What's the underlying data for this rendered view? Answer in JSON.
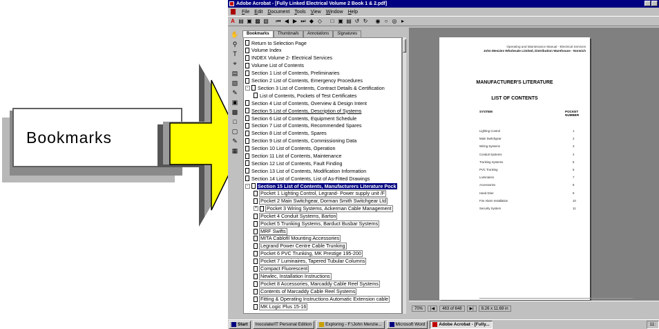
{
  "callout": {
    "label": "Bookmarks"
  },
  "window": {
    "title": "Adobe Acrobat - [Fully Linked Electrical Volume 2 Book 1 & 2.pdf]"
  },
  "menu": [
    "File",
    "Edit",
    "Document",
    "Tools",
    "View",
    "Window",
    "Help"
  ],
  "nav_tabs": [
    "Bookmarks",
    "Thumbnails",
    "Annotations",
    "Signatures"
  ],
  "bookmarks": [
    {
      "label": "Return to Selection Page"
    },
    {
      "label": "Volume Index"
    },
    {
      "label": "INDEX Volume 2- Electrical Services"
    },
    {
      "label": "Volume List of Contents"
    },
    {
      "label": "Section 1 List of Contents, Preliminaries"
    },
    {
      "label": "Section 2 List of Contents, Emergency Procedures"
    },
    {
      "label": "Section 3 List of Contents, Contract Details & Certification"
    },
    {
      "label": "List of Contents, Pockets of Test Certificates"
    },
    {
      "label": "Section 4 List of Contents, Overview & Design Intent"
    },
    {
      "label": "Section 5 List of Contents, Description of Systems"
    },
    {
      "label": "Section 6 List of Contents, Equipment Schedule"
    },
    {
      "label": "Section 7 List of Contents, Recommended Spares"
    },
    {
      "label": "Section 8 List of Contents, Spares"
    },
    {
      "label": "Section 9 List of Contents, Commissioning Data"
    },
    {
      "label": "Section 10 List of Contents, Operation"
    },
    {
      "label": "Section 11 List of Contents, Maintenance"
    },
    {
      "label": "Section 12 List of Contents, Fault Finding"
    },
    {
      "label": "Section 13 List of Contents, Modification Information"
    },
    {
      "label": "Section 14 List of Contents, List of As-Fitted Drawings"
    },
    {
      "label": "Section 15 List of Contents, Manufacturers Literature Pock"
    },
    {
      "label": "Pocket 1 Lighting Control, Legrand- Power supply unit /F"
    },
    {
      "label": "Pocket 2 Main Switchgear, Dorman Smith Switchgear Ltd"
    },
    {
      "label": "Pocket 3 Wiring Systems, Ackerman Cable Management"
    },
    {
      "label": "Pocket 4 Conduit Systems, Barton"
    },
    {
      "label": "Pocket 5 Trunking Systems, Barduct Busbar Systems"
    },
    {
      "label": "MRF Swifts"
    },
    {
      "label": "MITA Cablofil Mounting Accessories"
    },
    {
      "label": "Legrand Power Centre Cable Trunking"
    },
    {
      "label": "Pocket 6 PVC Trunking, MK Prestige 195-200"
    },
    {
      "label": "Pocket 7 Luminaires, Tapered Tubular Columns"
    },
    {
      "label": "Compact Fluorescent"
    },
    {
      "label": "Newlec, Installation Instructions"
    },
    {
      "label": "Pocket 8 Accessories, Marcaddy Cable Reel Systems"
    },
    {
      "label": "Contents of Marcaddy Cable Reel Systems"
    },
    {
      "label": "Fitting & Operating Instructions Automatic Extension cable"
    },
    {
      "label": "MK Logic Plus 15-16"
    }
  ],
  "document": {
    "header_line1": "Operating and Maintenance Manual - Electrical Services",
    "header_line2": "John Menzies Wholesale Limited, Distribution Warehouse - Norwich",
    "title": "MANUFACTURER'S LITERATURE",
    "subtitle": "LIST OF CONTENTS",
    "col_system": "SYSTEM",
    "col_pocket": "POCKET NUMBER",
    "rows": [
      {
        "system": "Lighting Control",
        "pocket": "1"
      },
      {
        "system": "Main Switchgear",
        "pocket": "2"
      },
      {
        "system": "Wiring Systems",
        "pocket": "3"
      },
      {
        "system": "Conduit Systems",
        "pocket": "4"
      },
      {
        "system": "Trunking Systems",
        "pocket": "5"
      },
      {
        "system": "PVC Trunking",
        "pocket": "6"
      },
      {
        "system": "Luminaires",
        "pocket": "7"
      },
      {
        "system": "Accessories",
        "pocket": "8"
      },
      {
        "system": "Hand Drier",
        "pocket": "9"
      },
      {
        "system": "Fire Alarm Installation",
        "pocket": "10"
      },
      {
        "system": "Security System",
        "pocket": "11"
      }
    ],
    "footer_left": "Section 15",
    "footer_center": "Manufacturers Literature",
    "footer_right": "Index"
  },
  "status": {
    "zoom": "70%",
    "page": "463 of 648",
    "size": "8.26 x 11.69 in"
  },
  "taskbar": {
    "start": "Start",
    "items": [
      {
        "label": "Inoculate/IT Personal Edition"
      },
      {
        "label": "Exploring - F:\\John Menzie..."
      },
      {
        "label": "Microsoft Word"
      },
      {
        "label": "Adobe Acrobat - [Fully..."
      }
    ],
    "clock": "11:"
  },
  "colors": {
    "title_bar": "#000080",
    "selection": "#000080",
    "arrow_fill": "#ffff00",
    "chrome": "#c0c0c0"
  }
}
